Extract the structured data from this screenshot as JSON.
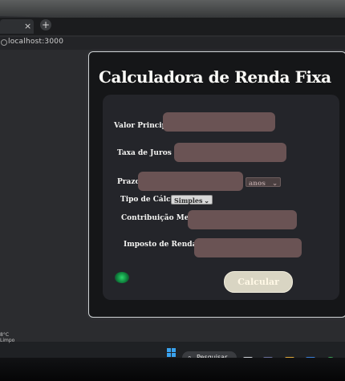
{
  "browser": {
    "tab_close": "×",
    "new_tab": "+",
    "url": "localhost:3000"
  },
  "page": {
    "title": "Calculadora de Renda Fixa"
  },
  "form": {
    "principal_label": "Valor Principal:",
    "taxa_label": "Taxa de Juros (%):",
    "prazo_label": "Prazo:",
    "prazo_unit": "anos",
    "tipo_label": "Tipo de Cálculo:",
    "tipo_value": "Simples",
    "contribuicao_label": "Contribuição Mensal:",
    "imposto_label": "Imposto de Renda (%):",
    "calcular_label": "Calcular"
  },
  "taskbar": {
    "search_label": "Pesquisar",
    "weather_temp": "8°C",
    "weather_desc": "Limpo"
  },
  "colors": {
    "field_bg": "#6a5354",
    "panel_bg": "#24252a",
    "button_bg": "#d9d5c3"
  }
}
